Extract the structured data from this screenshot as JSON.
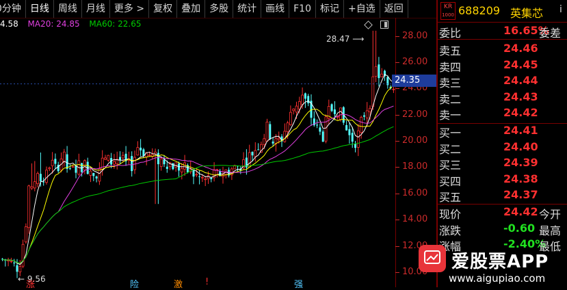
{
  "toolbar": {
    "items": [
      "0分钟",
      "日线",
      "周线",
      "月线",
      "更多 >",
      "复权",
      "叠加",
      "多股",
      "统计",
      "画线",
      "F10",
      "标记",
      "+自选",
      "返回"
    ]
  },
  "ma": {
    "ma5": "4.58",
    "ma20_label": "MA20: 24.85",
    "ma60_label": "MA60: 22.65",
    "colors": {
      "ma5": "#ffffff",
      "ma20": "#e040e0",
      "ma60": "#00cc00"
    }
  },
  "chart_data": {
    "type": "candlestick",
    "y_ticks": [
      "28.00",
      "26.00",
      "24.00",
      "22.00",
      "20.00",
      "18.00",
      "16.00",
      "14.00",
      "12.00",
      "10.00"
    ],
    "ylim": [
      10,
      28.5
    ],
    "current_price": "24.35",
    "max_label": "28.47",
    "min_label": "9.56",
    "colors": {
      "up": "#ff3030",
      "down": "#54ffff",
      "ma5": "#ffffff",
      "ma10": "#ffff00",
      "ma20": "#e040e0",
      "ma60": "#00cc00",
      "axis": "#cc2b2b"
    }
  },
  "stock": {
    "badge_top": "KR",
    "badge_bottom": "1000",
    "code": "688209",
    "name": "英集芯",
    "info": "i"
  },
  "weibi": {
    "label": "委比",
    "value": "16.65%",
    "label2": "委差"
  },
  "sell": [
    {
      "label": "卖五",
      "price": "24.46"
    },
    {
      "label": "卖四",
      "price": "24.45"
    },
    {
      "label": "卖三",
      "price": "24.44"
    },
    {
      "label": "卖二",
      "price": "24.43"
    },
    {
      "label": "卖一",
      "price": "24.42"
    }
  ],
  "buy": [
    {
      "label": "买一",
      "price": "24.41"
    },
    {
      "label": "买二",
      "price": "24.40"
    },
    {
      "label": "买三",
      "price": "24.39"
    },
    {
      "label": "买四",
      "price": "24.38"
    },
    {
      "label": "买五",
      "price": "24.37"
    }
  ],
  "quote": [
    {
      "label": "现价",
      "value": "24.42",
      "label2": "今开",
      "color": "#ff3030"
    },
    {
      "label": "涨跌",
      "value": "-0.60",
      "label2": "最高",
      "color": "#20e020"
    },
    {
      "label": "涨幅",
      "value": "-2.40%",
      "label2": "最低",
      "color": "#20e020"
    }
  ],
  "watermark": {
    "title": "爱股票APP",
    "url": "www.aigupiao.com"
  },
  "bottom_marks": [
    "涨",
    "险",
    "激",
    "!",
    "强"
  ]
}
